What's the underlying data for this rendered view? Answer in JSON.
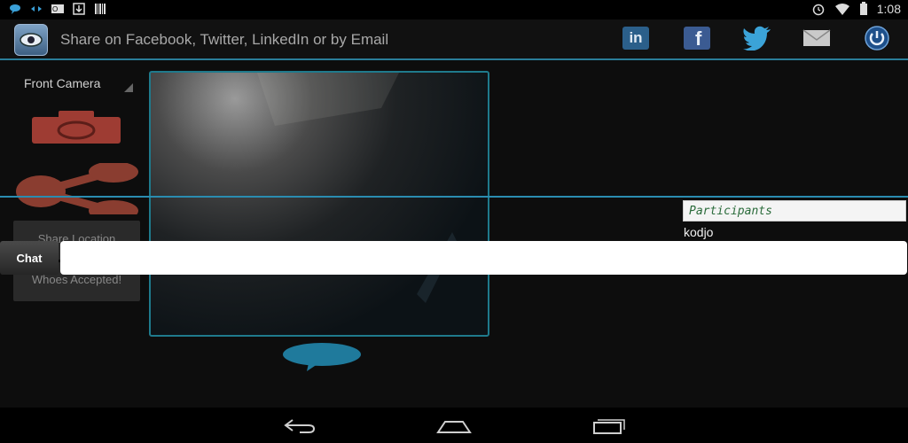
{
  "status_bar": {
    "time": "1:08",
    "icons_left": [
      "chat-bubble-icon",
      "network-arrows-icon",
      "outlook-icon",
      "download-icon",
      "barcode-icon"
    ],
    "icons_right": [
      "alarm-icon",
      "wifi-icon",
      "battery-icon"
    ]
  },
  "action_bar": {
    "title": "Share on Facebook, Twitter, LinkedIn or by Email",
    "share_targets": [
      "linkedin-icon",
      "facebook-icon",
      "twitter-icon",
      "email-icon",
      "power-icon"
    ],
    "linkedin_label": "in",
    "facebook_label": "f"
  },
  "camera": {
    "selected": "Front Camera"
  },
  "side_buttons": {
    "share_location": "Share Location",
    "whoes_accepted": "Whoes Accepted!"
  },
  "participants": {
    "header": "Participants",
    "items": [
      "kodjo"
    ]
  },
  "chat": {
    "label": "Chat",
    "input_value": "",
    "input_placeholder": ""
  },
  "nav": [
    "back-icon",
    "home-icon",
    "recents-icon"
  ],
  "colors": {
    "accent": "#2a8cb0",
    "camera_icon": "#b5453a",
    "bubble": "#1f7a9c"
  }
}
